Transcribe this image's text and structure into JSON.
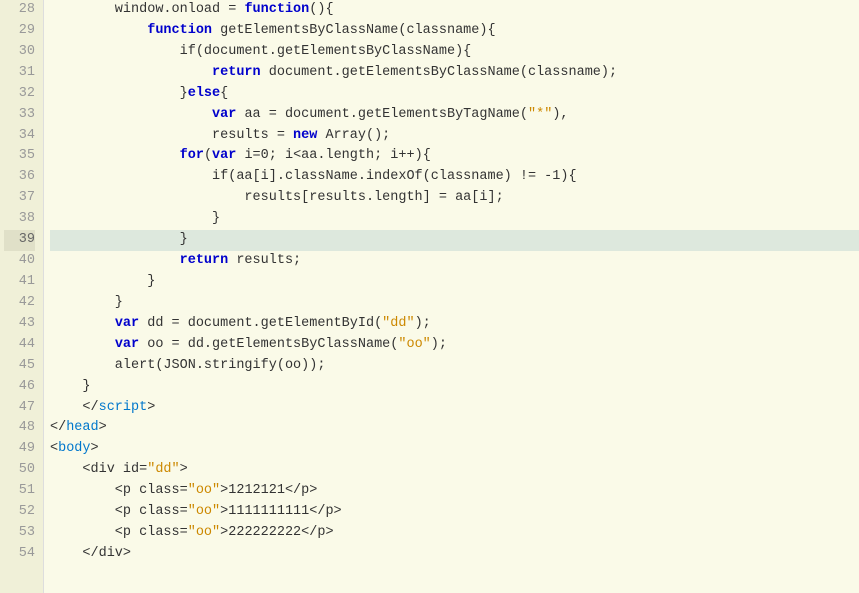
{
  "lines": [
    {
      "num": 28,
      "highlighted": false,
      "tokens": [
        {
          "t": "plain",
          "v": "        window.onload = "
        },
        {
          "t": "kw",
          "v": "function"
        },
        {
          "t": "plain",
          "v": "(){"
        }
      ]
    },
    {
      "num": 29,
      "highlighted": false,
      "tokens": [
        {
          "t": "plain",
          "v": "            "
        },
        {
          "t": "kw",
          "v": "function"
        },
        {
          "t": "plain",
          "v": " getElementsByClassName(classname){"
        }
      ]
    },
    {
      "num": 30,
      "highlighted": false,
      "tokens": [
        {
          "t": "plain",
          "v": "                if(document.getElementsByClassName){"
        }
      ]
    },
    {
      "num": 31,
      "highlighted": false,
      "tokens": [
        {
          "t": "plain",
          "v": "                    "
        },
        {
          "t": "kw",
          "v": "return"
        },
        {
          "t": "plain",
          "v": " document.getElementsByClassName(classname);"
        }
      ]
    },
    {
      "num": 32,
      "highlighted": false,
      "tokens": [
        {
          "t": "plain",
          "v": "                }"
        },
        {
          "t": "kw",
          "v": "else"
        },
        {
          "t": "plain",
          "v": "{"
        }
      ]
    },
    {
      "num": 33,
      "highlighted": false,
      "tokens": [
        {
          "t": "plain",
          "v": "                    "
        },
        {
          "t": "kw",
          "v": "var"
        },
        {
          "t": "plain",
          "v": " aa = document.getElementsByTagName("
        },
        {
          "t": "str",
          "v": "\"*\""
        },
        {
          "t": "plain",
          "v": "),"
        }
      ]
    },
    {
      "num": 34,
      "highlighted": false,
      "tokens": [
        {
          "t": "plain",
          "v": "                    results = "
        },
        {
          "t": "kw",
          "v": "new"
        },
        {
          "t": "plain",
          "v": " Array();"
        }
      ]
    },
    {
      "num": 35,
      "highlighted": false,
      "tokens": [
        {
          "t": "plain",
          "v": "                "
        },
        {
          "t": "kw",
          "v": "for"
        },
        {
          "t": "plain",
          "v": "("
        },
        {
          "t": "kw",
          "v": "var"
        },
        {
          "t": "plain",
          "v": " i=0; i<aa.length; i++){"
        }
      ]
    },
    {
      "num": 36,
      "highlighted": false,
      "tokens": [
        {
          "t": "plain",
          "v": "                    if(aa[i].className.indexOf(classname) != -1){"
        }
      ]
    },
    {
      "num": 37,
      "highlighted": false,
      "tokens": [
        {
          "t": "plain",
          "v": "                        results[results.length] = aa[i];"
        }
      ]
    },
    {
      "num": 38,
      "highlighted": false,
      "tokens": [
        {
          "t": "plain",
          "v": "                    }"
        }
      ]
    },
    {
      "num": 39,
      "highlighted": true,
      "tokens": [
        {
          "t": "plain",
          "v": "                }"
        }
      ]
    },
    {
      "num": 40,
      "highlighted": false,
      "tokens": [
        {
          "t": "plain",
          "v": "                "
        },
        {
          "t": "kw",
          "v": "return"
        },
        {
          "t": "plain",
          "v": " results;"
        }
      ]
    },
    {
      "num": 41,
      "highlighted": false,
      "tokens": [
        {
          "t": "plain",
          "v": "            }"
        }
      ]
    },
    {
      "num": 42,
      "highlighted": false,
      "tokens": [
        {
          "t": "plain",
          "v": "        }"
        }
      ]
    },
    {
      "num": 43,
      "highlighted": false,
      "tokens": [
        {
          "t": "plain",
          "v": "        "
        },
        {
          "t": "kw",
          "v": "var"
        },
        {
          "t": "plain",
          "v": " dd = document.getElementById("
        },
        {
          "t": "str",
          "v": "\"dd\""
        },
        {
          "t": "plain",
          "v": ");"
        }
      ]
    },
    {
      "num": 44,
      "highlighted": false,
      "tokens": [
        {
          "t": "plain",
          "v": "        "
        },
        {
          "t": "kw",
          "v": "var"
        },
        {
          "t": "plain",
          "v": " oo = dd.getElementsByClassName("
        },
        {
          "t": "str",
          "v": "\"oo\""
        },
        {
          "t": "plain",
          "v": ");"
        }
      ]
    },
    {
      "num": 45,
      "highlighted": false,
      "tokens": [
        {
          "t": "plain",
          "v": "        alert(JSON.stringify(oo));"
        }
      ]
    },
    {
      "num": 46,
      "highlighted": false,
      "tokens": [
        {
          "t": "plain",
          "v": "    }"
        }
      ]
    },
    {
      "num": 47,
      "highlighted": false,
      "tokens": [
        {
          "t": "plain",
          "v": "    </"
        },
        {
          "t": "tag",
          "v": "script"
        },
        {
          "t": "plain",
          "v": ">"
        }
      ]
    },
    {
      "num": 48,
      "highlighted": false,
      "tokens": [
        {
          "t": "plain",
          "v": "</"
        },
        {
          "t": "tag",
          "v": "head"
        },
        {
          "t": "plain",
          "v": ">"
        }
      ]
    },
    {
      "num": 49,
      "highlighted": false,
      "tokens": [
        {
          "t": "plain",
          "v": "<"
        },
        {
          "t": "tag",
          "v": "body"
        },
        {
          "t": "plain",
          "v": ">"
        }
      ]
    },
    {
      "num": 50,
      "highlighted": false,
      "tokens": [
        {
          "t": "plain",
          "v": "    <div id="
        },
        {
          "t": "str",
          "v": "\"dd\""
        },
        {
          "t": "plain",
          "v": ">"
        }
      ]
    },
    {
      "num": 51,
      "highlighted": false,
      "tokens": [
        {
          "t": "plain",
          "v": "        <p class="
        },
        {
          "t": "str",
          "v": "\"oo\""
        },
        {
          "t": "plain",
          "v": ">1212121</p>"
        }
      ]
    },
    {
      "num": 52,
      "highlighted": false,
      "tokens": [
        {
          "t": "plain",
          "v": "        <p class="
        },
        {
          "t": "str",
          "v": "\"oo\""
        },
        {
          "t": "plain",
          "v": ">1111111111</p>"
        }
      ]
    },
    {
      "num": 53,
      "highlighted": false,
      "tokens": [
        {
          "t": "plain",
          "v": "        <p class="
        },
        {
          "t": "str",
          "v": "\"oo\""
        },
        {
          "t": "plain",
          "v": ">222222222</p>"
        }
      ]
    },
    {
      "num": 54,
      "highlighted": false,
      "tokens": [
        {
          "t": "plain",
          "v": "    </div>"
        }
      ]
    }
  ]
}
